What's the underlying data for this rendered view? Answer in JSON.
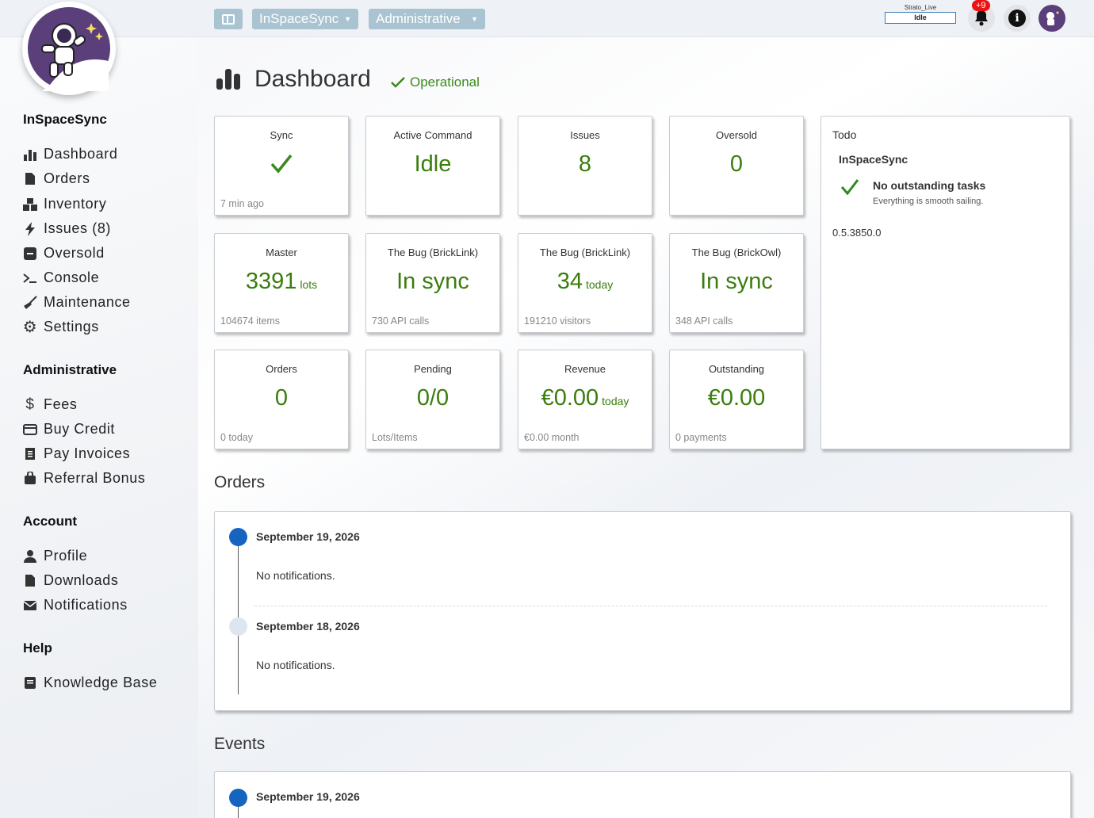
{
  "topbar": {
    "app_menu": "InSpaceSync",
    "admin_menu": "Administrative",
    "server_label": "Strato_Live",
    "server_state": "Idle",
    "notification_badge": "+9",
    "info_glyph": "i"
  },
  "sidebar": {
    "sections": [
      {
        "title": "InSpaceSync",
        "items": [
          {
            "label": "Dashboard",
            "icon": "chart-bar-icon"
          },
          {
            "label": "Orders",
            "icon": "file-icon"
          },
          {
            "label": "Inventory",
            "icon": "boxes-icon"
          },
          {
            "label": "Issues (8)",
            "icon": "bolt-icon"
          },
          {
            "label": "Oversold",
            "icon": "minus-square-icon"
          },
          {
            "label": "Console",
            "icon": "terminal-icon"
          },
          {
            "label": "Maintenance",
            "icon": "broom-icon"
          },
          {
            "label": "Settings",
            "icon": "gear-icon"
          }
        ]
      },
      {
        "title": "Administrative",
        "items": [
          {
            "label": "Fees",
            "icon": "dollar-icon"
          },
          {
            "label": "Buy Credit",
            "icon": "credit-card-icon"
          },
          {
            "label": "Pay Invoices",
            "icon": "receipt-icon"
          },
          {
            "label": "Referral Bonus",
            "icon": "bag-icon"
          }
        ]
      },
      {
        "title": "Account",
        "items": [
          {
            "label": "Profile",
            "icon": "user-icon"
          },
          {
            "label": "Downloads",
            "icon": "file-icon"
          },
          {
            "label": "Notifications",
            "icon": "envelope-icon"
          }
        ]
      },
      {
        "title": "Help",
        "items": [
          {
            "label": "Knowledge Base",
            "icon": "book-icon"
          }
        ]
      }
    ]
  },
  "header": {
    "title": "Dashboard",
    "status": "Operational"
  },
  "cards": [
    {
      "label": "Sync",
      "value": "",
      "unit": "",
      "sub": "7 min ago",
      "icon": "checkmark-icon"
    },
    {
      "label": "Active Command",
      "value": "Idle",
      "unit": "",
      "sub": ""
    },
    {
      "label": "Issues",
      "value": "8",
      "unit": "",
      "sub": ""
    },
    {
      "label": "Oversold",
      "value": "0",
      "unit": "",
      "sub": ""
    },
    {
      "label": "Master",
      "value": "3391",
      "unit": "lots",
      "sub": "104674 items"
    },
    {
      "label": "The Bug (BrickLink)",
      "value": "In sync",
      "unit": "",
      "sub": "730 API calls"
    },
    {
      "label": "The Bug (BrickLink)",
      "value": "34",
      "unit": "today",
      "sub": "191210 visitors"
    },
    {
      "label": "The Bug (BrickOwl)",
      "value": "In sync",
      "unit": "",
      "sub": "348 API calls"
    },
    {
      "label": "Orders",
      "value": "0",
      "unit": "",
      "sub": "0 today"
    },
    {
      "label": "Pending",
      "value": "0/0",
      "unit": "",
      "sub": "Lots/Items"
    },
    {
      "label": "Revenue",
      "value": "€0.00",
      "unit": "today",
      "sub": "€0.00 month"
    },
    {
      "label": "Outstanding",
      "value": "€0.00",
      "unit": "",
      "sub": "0 payments"
    }
  ],
  "todo": {
    "title": "Todo",
    "app": "InSpaceSync",
    "heading": "No outstanding tasks",
    "subtext": "Everything is smooth sailing.",
    "version": "0.5.3850.0"
  },
  "orders": {
    "title": "Orders",
    "entries": [
      {
        "date": "September 19, 2026",
        "message": "No notifications."
      },
      {
        "date": "September 18, 2026",
        "message": "No notifications."
      }
    ]
  },
  "events": {
    "title": "Events",
    "entries": [
      {
        "date": "September 19, 2026"
      }
    ]
  },
  "colors": {
    "accent_green": "#3a7d0d",
    "topbar_button": "#a9c3d1",
    "timeline_active": "#1565c0"
  }
}
